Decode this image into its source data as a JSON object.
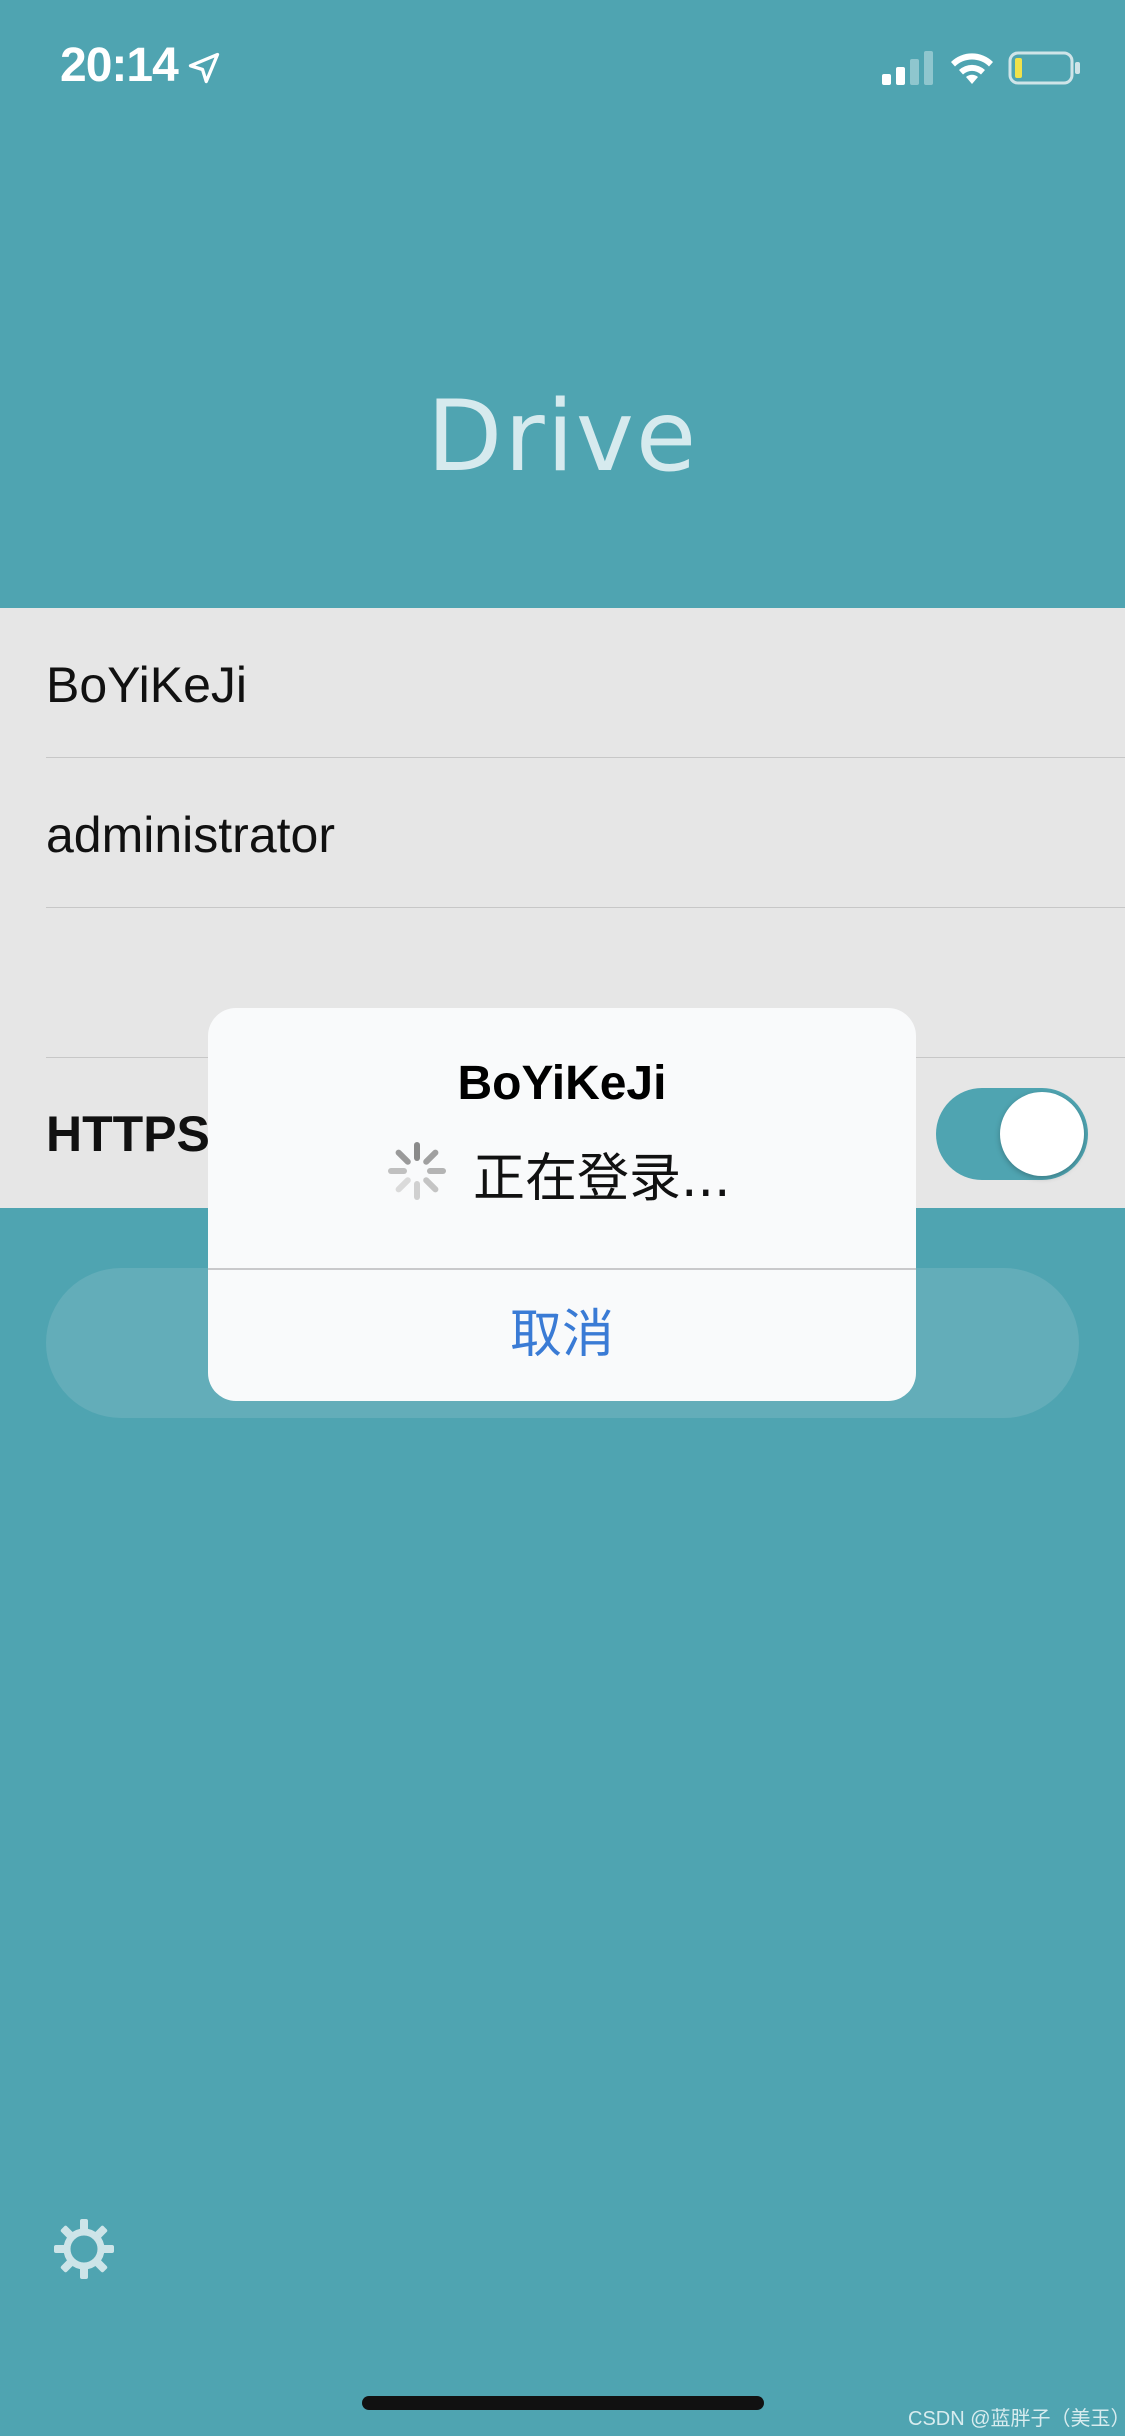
{
  "status_bar": {
    "time": "20:14",
    "location_icon": "location-arrow-icon",
    "signal_icon": "cellular-signal-icon",
    "wifi_icon": "wifi-icon",
    "battery_icon": "battery-low-icon"
  },
  "app": {
    "title": "Drive"
  },
  "form": {
    "server": "BoYiKeJi",
    "username": "administrator",
    "password": "",
    "https_label": "HTTPS",
    "https_enabled": true
  },
  "alert": {
    "title": "BoYiKeJi",
    "message": "正在登录...",
    "cancel_label": "取消"
  },
  "footer": {
    "settings_icon": "gear-icon",
    "watermark": "CSDN @蓝胖子（美玉）"
  },
  "colors": {
    "background": "#4fa4b1",
    "form_background": "#e6e6e6",
    "accent_blue": "#3a7bd5",
    "toggle_on": "#4fa4b1"
  }
}
